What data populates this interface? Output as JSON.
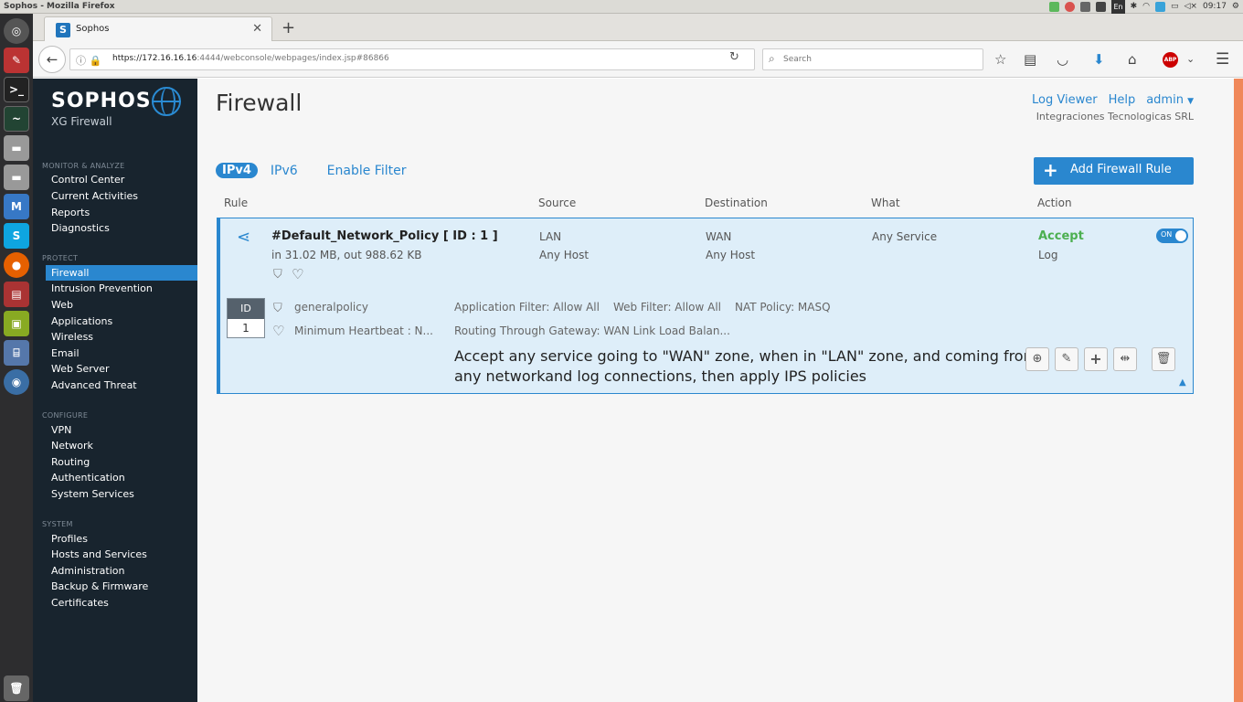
{
  "os": {
    "window_title": "Sophos - Mozilla Firefox",
    "clock": "09:17",
    "lang_badge": "En",
    "launcher_icons": [
      "ubuntu-icon",
      "settings-icon",
      "terminal-icon",
      "system-monitor-icon",
      "drive-icon",
      "drive-icon",
      "monitor-icon",
      "skype-icon",
      "firefox-icon",
      "files-icon",
      "vm-icon",
      "network-icon",
      "updates-icon",
      "trash-icon"
    ]
  },
  "browser": {
    "tab_title": "Sophos",
    "tab_icon_letter": "S",
    "url_host": "https://172.16.16.16",
    "url_rest": ":4444/webconsole/webpages/index.jsp#86866",
    "search_placeholder": "Search"
  },
  "sidebar": {
    "brand": "SOPHOS",
    "product": "XG Firewall",
    "sections": [
      {
        "title": "MONITOR & ANALYZE",
        "items": [
          "Control Center",
          "Current Activities",
          "Reports",
          "Diagnostics"
        ]
      },
      {
        "title": "PROTECT",
        "items": [
          "Firewall",
          "Intrusion Prevention",
          "Web",
          "Applications",
          "Wireless",
          "Email",
          "Web Server",
          "Advanced Threat"
        ]
      },
      {
        "title": "CONFIGURE",
        "items": [
          "VPN",
          "Network",
          "Routing",
          "Authentication",
          "System Services"
        ]
      },
      {
        "title": "SYSTEM",
        "items": [
          "Profiles",
          "Hosts and Services",
          "Administration",
          "Backup & Firmware",
          "Certificates"
        ]
      }
    ],
    "active": "Firewall"
  },
  "header": {
    "page_title": "Firewall",
    "links": [
      "Log Viewer",
      "Help",
      "admin"
    ],
    "org": "Integraciones Tecnologicas SRL"
  },
  "filters": {
    "ipv4": "IPv4",
    "ipv6": "IPv6",
    "enable_filter": "Enable Filter"
  },
  "add_rule_label": "Add Firewall Rule",
  "table": {
    "headers": [
      "Rule",
      "Source",
      "Destination",
      "What",
      "Action"
    ]
  },
  "rule": {
    "name": "#Default_Network_Policy [ ID : 1 ]",
    "traffic": "in 31.02 MB, out 988.62 KB",
    "source": [
      "LAN",
      "Any Host"
    ],
    "destination": [
      "WAN",
      "Any Host"
    ],
    "what": "Any Service",
    "action": "Accept",
    "log": "Log",
    "toggle": "ON",
    "id_label": "ID",
    "id_value": "1",
    "policy": "generalpolicy",
    "heartbeat": "Minimum Heartbeat : N...",
    "app_filter": "Application Filter: Allow All",
    "web_filter": "Web Filter: Allow All",
    "nat_policy": "NAT Policy: MASQ",
    "routing": "Routing Through Gateway: WAN Link Load Balan...",
    "description": "Accept any service going to \"WAN\" zone, when in \"LAN\" zone, and coming from any networkand log connections, then apply IPS policies"
  },
  "colors": {
    "accent": "#2a87cf",
    "sidebar_bg": "#18242e",
    "accept": "#4caf50",
    "rule_bg": "#deeef9"
  }
}
